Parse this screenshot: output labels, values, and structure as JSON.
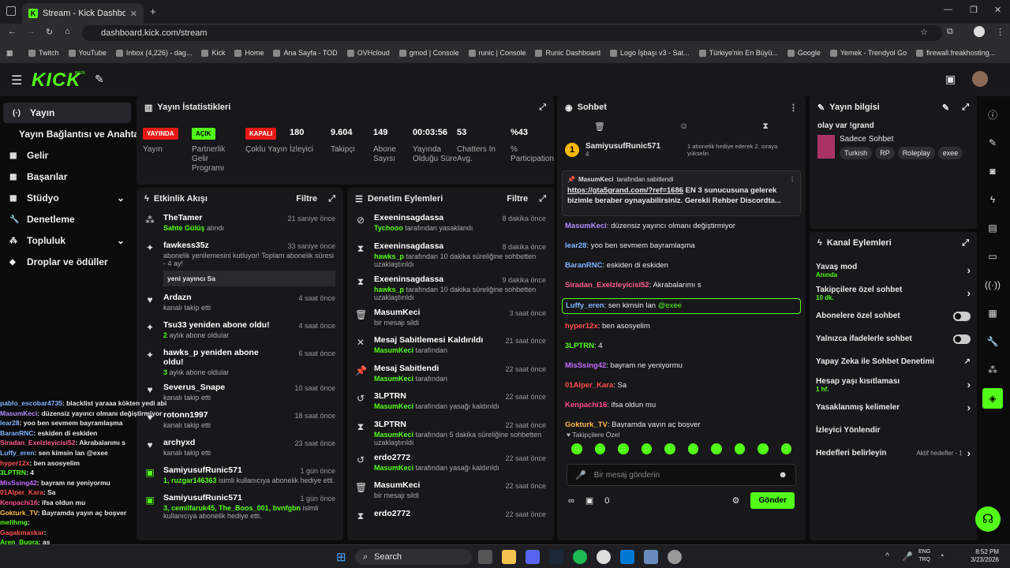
{
  "browser": {
    "tab_title": "Stream - Kick Dashboard",
    "url": "dashboard.kick.com/stream",
    "bookmarks": [
      "Twitch",
      "YouTube",
      "Inbox (4,226) - dag...",
      "Kick",
      "Home",
      "Ana Sayfa - TOD",
      "OVHcloud",
      "gmod | Console",
      "runic | Console",
      "Runic Dashboard",
      "Logo İşbaşı v3 - Sat...",
      "Türkiye'nin En Büyü...",
      "Google",
      "Yemek - Trendyol Go",
      "firewall.freakhosting..."
    ]
  },
  "brand": {
    "logo": "KICK",
    "beta": "BETA",
    "accent": "#53fc18"
  },
  "nav": {
    "items": [
      {
        "label": "Yayın",
        "icon": "broadcast-icon"
      },
      {
        "label": "Yayın Bağlantısı ve Anahtarı",
        "icon": ""
      },
      {
        "label": "Gelir",
        "icon": "revenue-icon"
      },
      {
        "label": "Başarılar",
        "icon": "achievements-icon"
      },
      {
        "label": "Stüdyo",
        "icon": "studio-icon"
      },
      {
        "label": "Denetleme",
        "icon": "moderation-icon"
      },
      {
        "label": "Topluluk",
        "icon": "community-icon"
      },
      {
        "label": "Droplar ve ödüller",
        "icon": "drops-icon"
      }
    ]
  },
  "stats": {
    "title": "Yayın İstatistikleri",
    "items": [
      {
        "value": "YAYINDA",
        "label": "Yayın",
        "badge": "red"
      },
      {
        "value": "AÇIK",
        "label": "Partnerlik Gelir Programı",
        "badge": "green"
      },
      {
        "value": "KAPALI",
        "label": "Çoklu Yayın",
        "badge": "red"
      },
      {
        "value": "180",
        "label": "İzleyici"
      },
      {
        "value": "9.604",
        "label": "Takipçi"
      },
      {
        "value": "149",
        "label": "Abone Sayısı"
      },
      {
        "value": "00:03:56",
        "label": "Yayında Olduğu Süre"
      },
      {
        "value": "53",
        "label": "Chatters In Avg."
      },
      {
        "value": "%43",
        "label": "% Participation"
      }
    ]
  },
  "activity": {
    "title": "Etkinlik Akışı",
    "filter": "Filtre",
    "events": [
      {
        "title": "TheTamer",
        "sub_hl": "Sahte Gülüş",
        "sub": " alındı",
        "time": "21 saniye önce",
        "icon": "gift-icon"
      },
      {
        "title": "fawkess35z",
        "sub_hl": "",
        "sub": "abonelik yenilemesini kutluyor! Toplam abonelik süresi - 4 ay!",
        "time": "33 saniye önce",
        "icon": "celebrate-icon",
        "note": "yeni yayıncı Sa"
      },
      {
        "title": "Ardazn",
        "sub_hl": "",
        "sub": "kanalı takip etti",
        "time": "4 saat önce",
        "icon": "heart-icon"
      },
      {
        "title": "Tsu33 yeniden abone oldu!",
        "sub_hl": "2",
        "sub": " aylık abone oldular",
        "time": "4 saat önce",
        "icon": "star-icon"
      },
      {
        "title": "hawks_p yeniden abone oldu!",
        "sub_hl": "3",
        "sub": " aylık abone oldular",
        "time": "6 saat önce",
        "icon": "star-icon"
      },
      {
        "title": "Severus_Snape",
        "sub_hl": "",
        "sub": "kanalı takip etti",
        "time": "10 saat önce",
        "icon": "heart-icon"
      },
      {
        "title": "rotonn1997",
        "sub_hl": "",
        "sub": "kanalı takip etti",
        "time": "18 saat önce",
        "icon": "heart-icon"
      },
      {
        "title": "archyxd",
        "sub_hl": "",
        "sub": "kanalı takip etti",
        "time": "23 saat önce",
        "icon": "heart-icon"
      },
      {
        "title": "SamiyusufRunic571",
        "sub_hl": "1, ruzgar146363",
        "sub": " isimli kullanıcıya abonelik hediye etti.",
        "time": "1 gün önce",
        "icon": "gift-sub-icon"
      },
      {
        "title": "SamiyusufRunic571",
        "sub_hl": "3, cemilfaruk45, The_Boos_001, bvnfgbn",
        "sub": " isimli kullanıcıya abonelik hediye etti.",
        "time": "1 gün önce",
        "icon": "gift-sub-icon"
      }
    ]
  },
  "modlog": {
    "title": "Denetim Eylemleri",
    "filter": "Filtre",
    "events": [
      {
        "title": "Exeeninsagdassa",
        "sub_hl": "Tychooo",
        "sub": " tarafından yasaklandı",
        "time": "8 dakika önce",
        "icon": "ban-icon"
      },
      {
        "title": "Exeeninsagdassa",
        "sub_hl": "hawks_p",
        "sub": " tarafından 10 dakika süreliğine sohbetten uzaklaştırıldı",
        "time": "8 dakika önce",
        "icon": "hourglass-icon"
      },
      {
        "title": "Exeeninsagdassa",
        "sub_hl": "hawks_p",
        "sub": " tarafından 10 dakika süreliğine sohbetten uzaklaştırıldı",
        "time": "9 dakika önce",
        "icon": "hourglass-icon"
      },
      {
        "title": "MasumKeci",
        "sub_hl": "",
        "sub": "bir mesajı sildi",
        "time": "3 saat önce",
        "icon": "trash-icon"
      },
      {
        "title": "Mesaj Sabitlemesi Kaldırıldı",
        "sub_hl": "MasumKeci",
        "sub": " tarafından",
        "time": "21 saat önce",
        "icon": "unpin-icon"
      },
      {
        "title": "Mesaj Sabitlendi",
        "sub_hl": "MasumKeci",
        "sub": " tarafından",
        "time": "22 saat önce",
        "icon": "pin-icon"
      },
      {
        "title": "3LPTRN",
        "sub_hl": "MasumKeci",
        "sub": " tarafından yasağı kaldırıldı",
        "time": "22 saat önce",
        "icon": "unban-icon"
      },
      {
        "title": "3LPTRN",
        "sub_hl": "MasumKeci",
        "sub": " tarafından 5 dakika süreliğine sohbetten uzaklaştırıldı",
        "time": "22 saat önce",
        "icon": "hourglass-icon"
      },
      {
        "title": "erdo2772",
        "sub_hl": "MasumKeci",
        "sub": " tarafından yasağı kaldırıldı",
        "time": "22 saat önce",
        "icon": "unban-icon"
      },
      {
        "title": "MasumKeci",
        "sub_hl": "",
        "sub": "bir mesajı sildi",
        "time": "22 saat önce",
        "icon": "trash-icon"
      },
      {
        "title": "erdo2772",
        "sub_hl": "",
        "sub": "",
        "time": "22 saat önce",
        "icon": "hourglass-icon"
      }
    ]
  },
  "chat": {
    "title": "Sohbet",
    "top_user": "SamiyusufRunic571",
    "top_rank": "1",
    "top_count": "4",
    "top_note": "1 abonelik hediye ederek 2. sıraya yükselin",
    "pinned_by": "MasumKeci",
    "pinned_suffix": "tarafından sabitlendi",
    "pinned_link": "https://gta5grand.com/?ref=1686",
    "pinned_text": " EN 3 sunucusuna gelerek bizimle beraber oynayabilirsiniz. Gerekli Rehber Discordta...",
    "messages": [
      {
        "user": "MasumKeci",
        "text": ": düzensiz yayıncı olmanı değiştirmiyor",
        "color": "#b58cff"
      },
      {
        "user": "lear28",
        "text": ": yoo ben sevmem bayramlaşma",
        "color": "#7fb5ff"
      },
      {
        "user": "BaranRNC",
        "text": ": eskiden di eskiden",
        "color": "#7fb5ff"
      },
      {
        "user": "Siradan_Exelzleyicisi52",
        "text": ": Akrabalarımı s",
        "color": "#ff5b8a"
      },
      {
        "user": "Luffy_eren",
        "text": ": sen kimsin lan ",
        "mention": "@exee",
        "color": "#7fb5ff",
        "highlight": true
      },
      {
        "user": "hyper12x",
        "text": ": ben asosyelim",
        "color": "#ff4d4d"
      },
      {
        "user": "3LPTRN",
        "text": ": 4",
        "color": "#53fc18"
      },
      {
        "user": "MisSsing42",
        "text": ": bayram ne yeniyormu",
        "color": "#c26bff"
      },
      {
        "user": "01Alper_Kara",
        "text": ": Sa",
        "color": "#ff4d4d"
      },
      {
        "user": "Kenpachi16",
        "text": ": ifsa oldun mu",
        "color": "#ff4d8a"
      },
      {
        "user": "Gokturk_TV",
        "text": ": Bayramda yayın aç boşver",
        "color": "#ffb84d"
      },
      {
        "user": "melihmg",
        "text": ":",
        "color": "#53fc18"
      },
      {
        "user": "Gagakmaskar",
        "text": ":",
        "color": "#ff4d4d"
      },
      {
        "user": "Aren_Bugra",
        "text": ": as",
        "color": "#53fc18"
      }
    ],
    "followers_only": "Takipçilere Özel",
    "placeholder": "Bir mesaj gönderin",
    "points": "0",
    "send": "Gönder"
  },
  "info": {
    "title": "Yayın bilgisi",
    "stream_title": "olay var !grand",
    "category": "Sadece Sohbet",
    "tags": [
      "Turkish",
      "RP",
      "Roleplay",
      "exee"
    ]
  },
  "actions": {
    "title": "Kanal Eylemleri",
    "items": [
      {
        "label": "Yavaş mod",
        "sub": "Anında",
        "control": "chevron"
      },
      {
        "label": "Takipçilere özel sohbet",
        "sub": "10 dk.",
        "control": "chevron"
      },
      {
        "label": "Abonelere özel sohbet",
        "sub": "",
        "control": "toggle"
      },
      {
        "label": "Yalnızca ifadelerle sohbet",
        "sub": "",
        "control": "toggle"
      },
      {
        "label": "Yapay Zeka ile Sohbet Denetimi",
        "sub": "",
        "control": "external"
      },
      {
        "label": "Hesap yaşı kısıtlaması",
        "sub": "1 hf.",
        "control": "chevron"
      },
      {
        "label": "Yasaklanmış kelimeler",
        "sub": "",
        "control": "chevron"
      },
      {
        "label": "İzleyici Yönlendir",
        "sub": "",
        "control": ""
      },
      {
        "label": "Hedefleri belirleyin",
        "sub": "",
        "control": "chevron",
        "status": "Aktif hedefler - 1"
      }
    ]
  },
  "overlay": [
    {
      "user": "pablo_escobar4735",
      "text": ": blacklist yaraaa kökten yedi abi",
      "color": "#7fb5ff"
    },
    {
      "user": "MasumKeci",
      "text": ": düzensiz yayıncı olmanı değiştirmiyor",
      "color": "#b58cff"
    },
    {
      "user": "lear28",
      "text": ": yoo ben sevmem bayramlaşma",
      "color": "#7fb5ff"
    },
    {
      "user": "BaranRNC",
      "text": ": eskiden di eskiden",
      "color": "#7fb5ff"
    },
    {
      "user": "Siradan_Exelzleyicisi52",
      "text": ": Akrabalarımı s",
      "color": "#ff5b8a"
    },
    {
      "user": "Luffy_eren",
      "text": ": sen kimsin lan @exee",
      "color": "#7fb5ff"
    },
    {
      "user": "hyper12x",
      "text": ": ben asosyelim",
      "color": "#ff4d4d"
    },
    {
      "user": "3LPTRN",
      "text": ": 4",
      "color": "#53fc18"
    },
    {
      "user": "MisSsing42",
      "text": ": bayram ne yeniyormu",
      "color": "#c26bff"
    },
    {
      "user": "01Alper_Kara",
      "text": ": Sa",
      "color": "#ff4d4d"
    },
    {
      "user": "Kenpachi16",
      "text": ": ifsa oldun mu",
      "color": "#ff4d8a"
    },
    {
      "user": "Gokturk_TV",
      "text": ": Bayramda yayın aç boşver",
      "color": "#ffb84d"
    },
    {
      "user": "melihmg",
      "text": ":",
      "color": "#53fc18"
    },
    {
      "user": "Gagakmaskar",
      "text": ":",
      "color": "#ff4d4d"
    },
    {
      "user": "Aren_Bugra",
      "text": ": as",
      "color": "#53fc18"
    }
  ],
  "taskbar": {
    "search": "Search",
    "lang": "ENG",
    "lang2": "TRQ",
    "time": "8:52 PM",
    "date": "3/23/2026"
  }
}
